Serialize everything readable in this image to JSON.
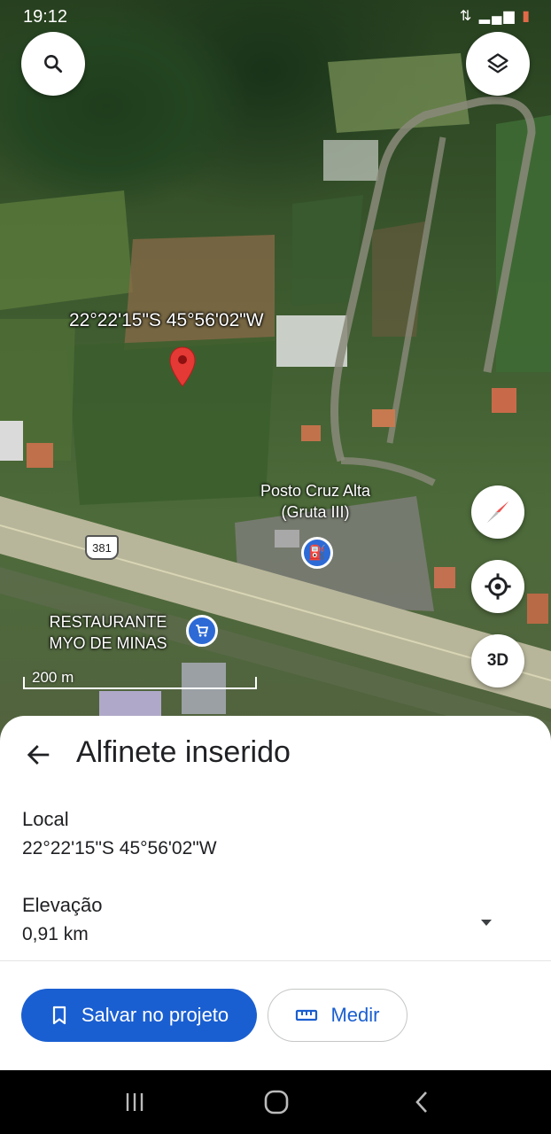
{
  "status_bar": {
    "time": "19:12",
    "icons": [
      "signal-icon",
      "wifi-icon",
      "battery-icon"
    ]
  },
  "map": {
    "pin_coordinates_label": "22°22'15\"S 45°56'02\"W",
    "poi_gas_station": "Posto Cruz Alta (Gruta III)",
    "poi_restaurant": "RESTAURANTE MYO DE MINAS",
    "road_shield": "381",
    "scale_label": "200 m",
    "compass": "compass-icon",
    "button_3d": "3D"
  },
  "sheet": {
    "title": "Alfinete inserido",
    "local_label": "Local",
    "local_value": "22°22'15\"S 45°56'02\"W",
    "elevation_label": "Elevação",
    "elevation_value": "0,91 km",
    "save_button": "Salvar no projeto",
    "measure_button": "Medir"
  },
  "colors": {
    "accent": "#1a5fd1",
    "pin": "#e53935",
    "sheet_bg": "#ffffff"
  }
}
